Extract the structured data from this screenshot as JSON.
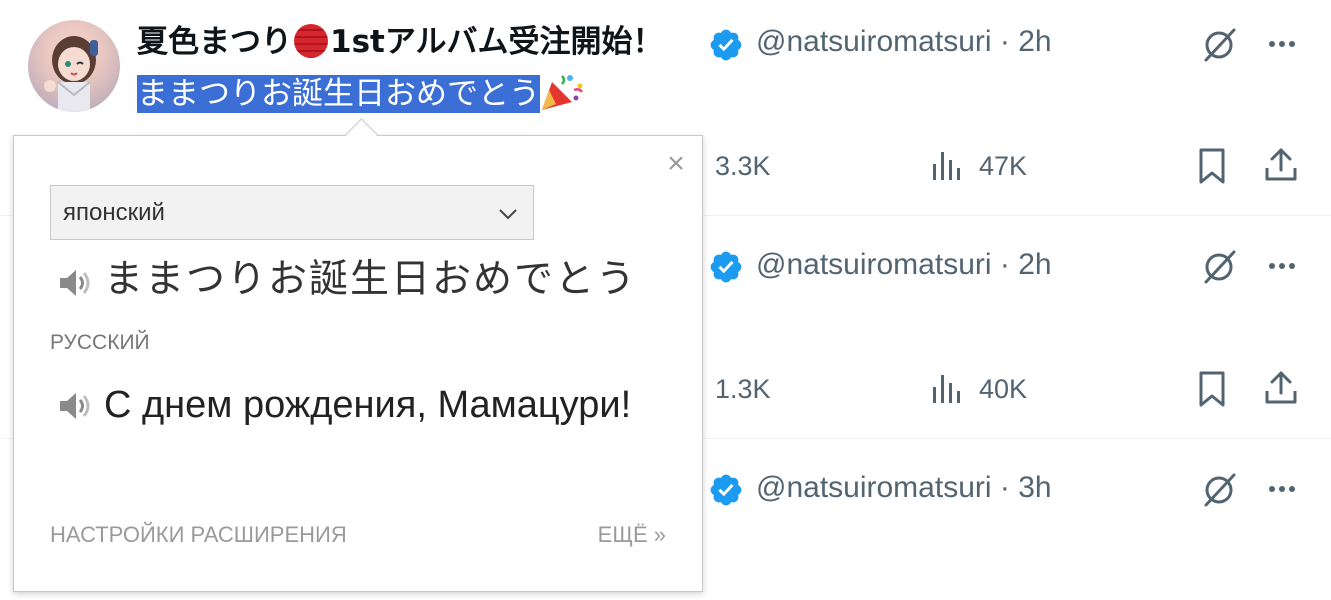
{
  "tweets": [
    {
      "author_name_part1": "夏色まつり",
      "author_name_part2": "1stアルバム受注開始！",
      "handle": "@natsuiromatsuri · 2h",
      "text_selected": "ままつりお誕生日おめでとう",
      "replies": "",
      "retweets": "3.3K",
      "views": "47K"
    },
    {
      "handle": "@natsuiromatsuri · 2h",
      "retweets": "1.3K",
      "views": "40K"
    },
    {
      "handle": "@natsuiromatsuri · 3h"
    }
  ],
  "translation_popup": {
    "source_language": "японский",
    "source_text": "ままつりお誕生日おめでとう",
    "target_language": "РУССКИЙ",
    "target_text": "С днем рождения, Мамацури!",
    "settings_link": "НАСТРОЙКИ РАСШИРЕНИЯ",
    "more_link": "ЕЩЁ »",
    "close_symbol": "×"
  },
  "colors": {
    "selection": "#3b6fd6",
    "verified": "#1d9bf0",
    "secondary_text": "#536471"
  }
}
